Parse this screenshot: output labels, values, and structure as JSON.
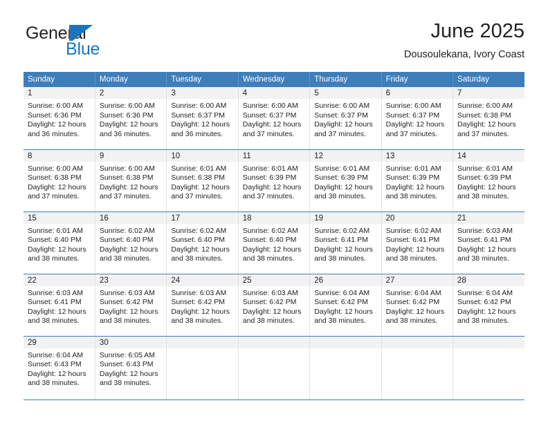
{
  "brand": {
    "name_top": "General",
    "name_bottom": "Blue",
    "accent_color": "#1b75bb"
  },
  "header": {
    "title": "June 2025",
    "subtitle": "Dousoulekana, Ivory Coast"
  },
  "theme": {
    "header_blue": "#3d7ebb",
    "daynum_bg": "#f2f2f2",
    "text_color": "#222222"
  },
  "calendar": {
    "weekday_headers": [
      "Sunday",
      "Monday",
      "Tuesday",
      "Wednesday",
      "Thursday",
      "Friday",
      "Saturday"
    ],
    "weeks": [
      [
        {
          "day": "1",
          "sunrise": "Sunrise: 6:00 AM",
          "sunset": "Sunset: 6:36 PM",
          "daylight1": "Daylight: 12 hours",
          "daylight2": "and 36 minutes."
        },
        {
          "day": "2",
          "sunrise": "Sunrise: 6:00 AM",
          "sunset": "Sunset: 6:36 PM",
          "daylight1": "Daylight: 12 hours",
          "daylight2": "and 36 minutes."
        },
        {
          "day": "3",
          "sunrise": "Sunrise: 6:00 AM",
          "sunset": "Sunset: 6:37 PM",
          "daylight1": "Daylight: 12 hours",
          "daylight2": "and 36 minutes."
        },
        {
          "day": "4",
          "sunrise": "Sunrise: 6:00 AM",
          "sunset": "Sunset: 6:37 PM",
          "daylight1": "Daylight: 12 hours",
          "daylight2": "and 37 minutes."
        },
        {
          "day": "5",
          "sunrise": "Sunrise: 6:00 AM",
          "sunset": "Sunset: 6:37 PM",
          "daylight1": "Daylight: 12 hours",
          "daylight2": "and 37 minutes."
        },
        {
          "day": "6",
          "sunrise": "Sunrise: 6:00 AM",
          "sunset": "Sunset: 6:37 PM",
          "daylight1": "Daylight: 12 hours",
          "daylight2": "and 37 minutes."
        },
        {
          "day": "7",
          "sunrise": "Sunrise: 6:00 AM",
          "sunset": "Sunset: 6:38 PM",
          "daylight1": "Daylight: 12 hours",
          "daylight2": "and 37 minutes."
        }
      ],
      [
        {
          "day": "8",
          "sunrise": "Sunrise: 6:00 AM",
          "sunset": "Sunset: 6:38 PM",
          "daylight1": "Daylight: 12 hours",
          "daylight2": "and 37 minutes."
        },
        {
          "day": "9",
          "sunrise": "Sunrise: 6:00 AM",
          "sunset": "Sunset: 6:38 PM",
          "daylight1": "Daylight: 12 hours",
          "daylight2": "and 37 minutes."
        },
        {
          "day": "10",
          "sunrise": "Sunrise: 6:01 AM",
          "sunset": "Sunset: 6:38 PM",
          "daylight1": "Daylight: 12 hours",
          "daylight2": "and 37 minutes."
        },
        {
          "day": "11",
          "sunrise": "Sunrise: 6:01 AM",
          "sunset": "Sunset: 6:39 PM",
          "daylight1": "Daylight: 12 hours",
          "daylight2": "and 37 minutes."
        },
        {
          "day": "12",
          "sunrise": "Sunrise: 6:01 AM",
          "sunset": "Sunset: 6:39 PM",
          "daylight1": "Daylight: 12 hours",
          "daylight2": "and 38 minutes."
        },
        {
          "day": "13",
          "sunrise": "Sunrise: 6:01 AM",
          "sunset": "Sunset: 6:39 PM",
          "daylight1": "Daylight: 12 hours",
          "daylight2": "and 38 minutes."
        },
        {
          "day": "14",
          "sunrise": "Sunrise: 6:01 AM",
          "sunset": "Sunset: 6:39 PM",
          "daylight1": "Daylight: 12 hours",
          "daylight2": "and 38 minutes."
        }
      ],
      [
        {
          "day": "15",
          "sunrise": "Sunrise: 6:01 AM",
          "sunset": "Sunset: 6:40 PM",
          "daylight1": "Daylight: 12 hours",
          "daylight2": "and 38 minutes."
        },
        {
          "day": "16",
          "sunrise": "Sunrise: 6:02 AM",
          "sunset": "Sunset: 6:40 PM",
          "daylight1": "Daylight: 12 hours",
          "daylight2": "and 38 minutes."
        },
        {
          "day": "17",
          "sunrise": "Sunrise: 6:02 AM",
          "sunset": "Sunset: 6:40 PM",
          "daylight1": "Daylight: 12 hours",
          "daylight2": "and 38 minutes."
        },
        {
          "day": "18",
          "sunrise": "Sunrise: 6:02 AM",
          "sunset": "Sunset: 6:40 PM",
          "daylight1": "Daylight: 12 hours",
          "daylight2": "and 38 minutes."
        },
        {
          "day": "19",
          "sunrise": "Sunrise: 6:02 AM",
          "sunset": "Sunset: 6:41 PM",
          "daylight1": "Daylight: 12 hours",
          "daylight2": "and 38 minutes."
        },
        {
          "day": "20",
          "sunrise": "Sunrise: 6:02 AM",
          "sunset": "Sunset: 6:41 PM",
          "daylight1": "Daylight: 12 hours",
          "daylight2": "and 38 minutes."
        },
        {
          "day": "21",
          "sunrise": "Sunrise: 6:03 AM",
          "sunset": "Sunset: 6:41 PM",
          "daylight1": "Daylight: 12 hours",
          "daylight2": "and 38 minutes."
        }
      ],
      [
        {
          "day": "22",
          "sunrise": "Sunrise: 6:03 AM",
          "sunset": "Sunset: 6:41 PM",
          "daylight1": "Daylight: 12 hours",
          "daylight2": "and 38 minutes."
        },
        {
          "day": "23",
          "sunrise": "Sunrise: 6:03 AM",
          "sunset": "Sunset: 6:42 PM",
          "daylight1": "Daylight: 12 hours",
          "daylight2": "and 38 minutes."
        },
        {
          "day": "24",
          "sunrise": "Sunrise: 6:03 AM",
          "sunset": "Sunset: 6:42 PM",
          "daylight1": "Daylight: 12 hours",
          "daylight2": "and 38 minutes."
        },
        {
          "day": "25",
          "sunrise": "Sunrise: 6:03 AM",
          "sunset": "Sunset: 6:42 PM",
          "daylight1": "Daylight: 12 hours",
          "daylight2": "and 38 minutes."
        },
        {
          "day": "26",
          "sunrise": "Sunrise: 6:04 AM",
          "sunset": "Sunset: 6:42 PM",
          "daylight1": "Daylight: 12 hours",
          "daylight2": "and 38 minutes."
        },
        {
          "day": "27",
          "sunrise": "Sunrise: 6:04 AM",
          "sunset": "Sunset: 6:42 PM",
          "daylight1": "Daylight: 12 hours",
          "daylight2": "and 38 minutes."
        },
        {
          "day": "28",
          "sunrise": "Sunrise: 6:04 AM",
          "sunset": "Sunset: 6:42 PM",
          "daylight1": "Daylight: 12 hours",
          "daylight2": "and 38 minutes."
        }
      ],
      [
        {
          "day": "29",
          "sunrise": "Sunrise: 6:04 AM",
          "sunset": "Sunset: 6:43 PM",
          "daylight1": "Daylight: 12 hours",
          "daylight2": "and 38 minutes."
        },
        {
          "day": "30",
          "sunrise": "Sunrise: 6:05 AM",
          "sunset": "Sunset: 6:43 PM",
          "daylight1": "Daylight: 12 hours",
          "daylight2": "and 38 minutes."
        },
        {
          "day": "",
          "sunrise": "",
          "sunset": "",
          "daylight1": "",
          "daylight2": ""
        },
        {
          "day": "",
          "sunrise": "",
          "sunset": "",
          "daylight1": "",
          "daylight2": ""
        },
        {
          "day": "",
          "sunrise": "",
          "sunset": "",
          "daylight1": "",
          "daylight2": ""
        },
        {
          "day": "",
          "sunrise": "",
          "sunset": "",
          "daylight1": "",
          "daylight2": ""
        },
        {
          "day": "",
          "sunrise": "",
          "sunset": "",
          "daylight1": "",
          "daylight2": ""
        }
      ]
    ]
  }
}
